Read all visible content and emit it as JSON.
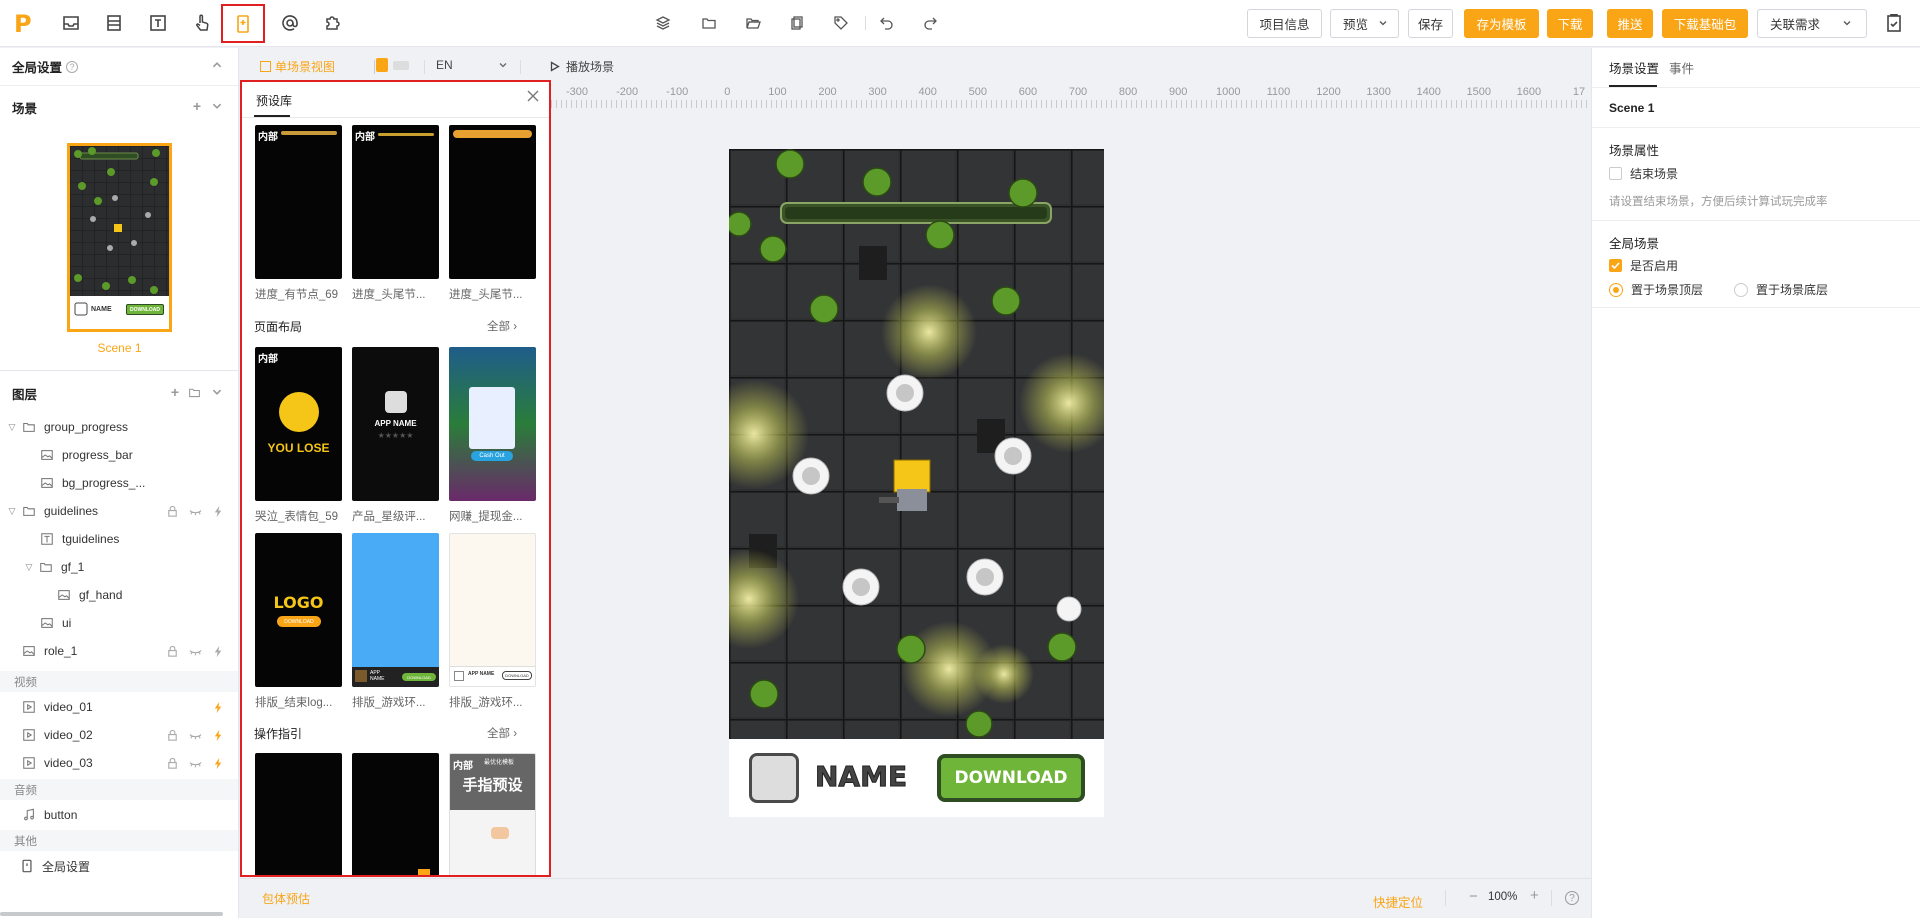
{
  "topbar": {
    "logo": "P",
    "left_icons": [
      "inbox-icon",
      "list-icon",
      "text-icon",
      "hand-pointer-icon",
      "preset-icon",
      "at-icon",
      "puzzle-icon"
    ],
    "center_icons": [
      "layers-icon",
      "folder-icon",
      "folder-open-icon",
      "copy-icon",
      "tag-icon",
      "undo-icon",
      "redo-icon"
    ],
    "buttons": {
      "project_info": "项目信息",
      "preview": "预览",
      "save": "保存",
      "save_template": "存为模板",
      "download": "下载",
      "push": "推送",
      "download_base": "下载基础包",
      "related": "关联需求"
    }
  },
  "left": {
    "global_settings": "全局设置",
    "scene_title": "场景",
    "scene_name": "Scene 1",
    "scene_thumb": {
      "name": "NAME",
      "download": "DOWNLOAD"
    },
    "layers_title": "图层",
    "layers": [
      {
        "label": "group_progress"
      },
      {
        "label": "progress_bar"
      },
      {
        "label": "bg_progress_..."
      },
      {
        "label": "guidelines"
      },
      {
        "label": "tguidelines"
      },
      {
        "label": "gf_1"
      },
      {
        "label": "gf_hand"
      },
      {
        "label": "ui"
      },
      {
        "label": "role_1"
      }
    ],
    "video_section": "视频",
    "videos": [
      {
        "label": "video_01"
      },
      {
        "label": "video_02"
      },
      {
        "label": "video_03"
      }
    ],
    "audio_section": "音频",
    "audios": [
      {
        "label": "button"
      }
    ],
    "other_section": "其他",
    "others": [
      {
        "label": "全局设置"
      }
    ]
  },
  "canvas_toolbar": {
    "single_view": "单场景视图",
    "lang": "EN",
    "play": "播放场景"
  },
  "preset": {
    "tab": "预设库",
    "row1": [
      "进度_有节点_69",
      "进度_头尾节...",
      "进度_头尾节..."
    ],
    "layout_section": "页面布局",
    "all": "全部",
    "layout_items": [
      "哭泣_表情包_59",
      "产品_星级评...",
      "网赚_提现金...",
      "排版_结束log...",
      "排版_游戏环...",
      "排版_游戏环..."
    ],
    "guide_section": "操作指引",
    "internal_tag": "内部",
    "thumb_text": {
      "you_lose": "YOU LOSE",
      "app_name": "APP NAME",
      "logo": "LOGO",
      "download": "DOWNLOAD",
      "cash_out": "Cash Out",
      "app": "APP",
      "name": "NAME",
      "finger": "手指预设",
      "finger_sub": "最优化模板"
    }
  },
  "ruler": [
    "-300",
    "-200",
    "-100",
    "0",
    "100",
    "200",
    "300",
    "400",
    "500",
    "600",
    "700",
    "800",
    "900",
    "1000",
    "1100",
    "1200",
    "1300",
    "1400",
    "1500",
    "1600",
    "17"
  ],
  "scene_canvas": {
    "name": "NAME",
    "download": "DOWNLOAD"
  },
  "bottom": {
    "estimate": "包体预估",
    "locate": "快捷定位",
    "zoom": "100%"
  },
  "right": {
    "tab_scene": "场景设置",
    "tab_event": "事件",
    "scene_name": "Scene 1",
    "props_title": "场景属性",
    "end_scene": "结束场景",
    "end_hint": "请设置结束场景，方便后续计算试玩完成率",
    "global_title": "全局场景",
    "enabled": "是否启用",
    "top": "置于场景顶层",
    "bottom": "置于场景底层"
  },
  "colors": {
    "accent": "#f9a515",
    "highlight_border": "#e02020",
    "download_green": "#6fb53a"
  }
}
